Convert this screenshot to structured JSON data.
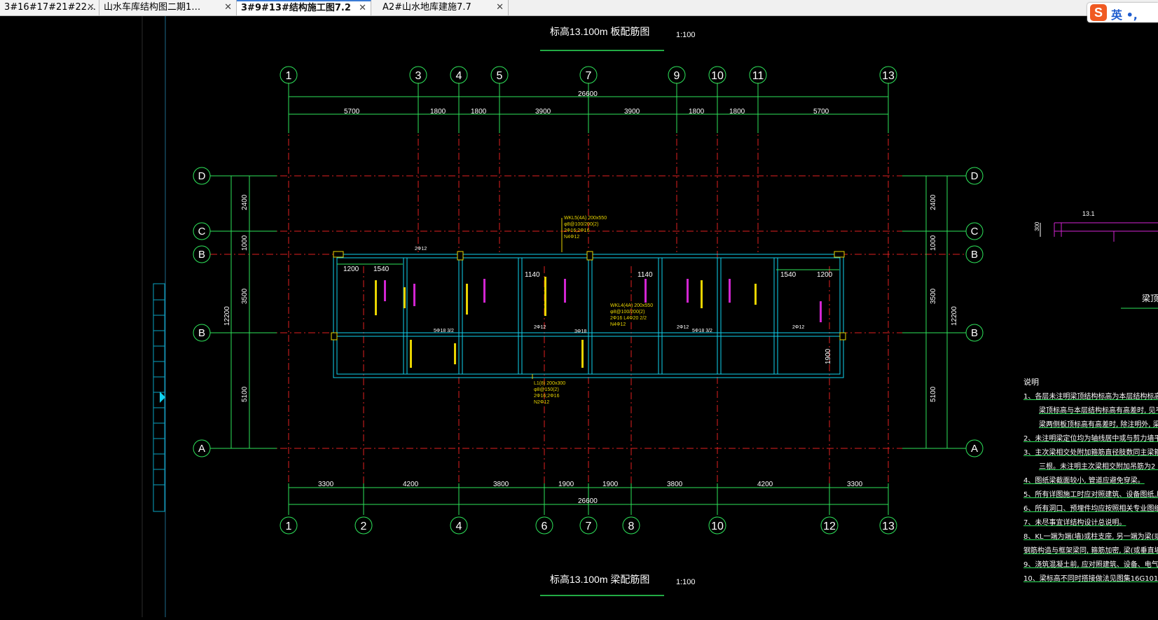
{
  "tabs": [
    {
      "label": "3#16#17#21#22…",
      "active": false
    },
    {
      "label": "山水车库结构图二期1…",
      "active": false
    },
    {
      "label": "3#9#13#结构施工图7.2",
      "active": true
    },
    {
      "label": "A2#山水地库建施7.7",
      "active": false
    }
  ],
  "tab_close_glyph": "✕",
  "ime": {
    "logo": "S",
    "text": "英 •,"
  },
  "drawing": {
    "top_title": "标高13.100m  板配筋图",
    "bottom_title": "标高13.100m  梁配筋图",
    "scale": "1:100",
    "top_axes": [
      "1",
      "3",
      "4",
      "5",
      "7",
      "9",
      "10",
      "11",
      "13"
    ],
    "bottom_axes": [
      "1",
      "2",
      "4",
      "6",
      "7",
      "8",
      "10",
      "12",
      "13"
    ],
    "left_axes": [
      "D",
      "C",
      "B",
      "B",
      "A"
    ],
    "right_axes": [
      "D",
      "C",
      "B",
      "B",
      "A"
    ],
    "top_total": "26600",
    "top_dims": [
      "5700",
      "1800",
      "1800",
      "3900",
      "3900",
      "1800",
      "1800",
      "5700"
    ],
    "bottom_total": "26600",
    "bottom_dims": [
      "3300",
      "4200",
      "3800",
      "1900",
      "1900",
      "3800",
      "4200",
      "3300"
    ],
    "left_dims": [
      "2400",
      "1000",
      "3500",
      "5100"
    ],
    "left_total": "12200",
    "right_dims": [
      "2400",
      "1000",
      "3500",
      "5100"
    ],
    "right_total": "12200",
    "plan_dims": [
      "1200",
      "1540",
      "1140",
      "1140",
      "1540",
      "1200",
      "1900"
    ],
    "beam_labels": [
      "WKL5(4A) 200x550",
      "φ8@100/200(2)",
      "2Φ16;2Φ16",
      "N4Φ12",
      "WKL4(4A) 200x550",
      "φ8@100/200(2)",
      "2Φ16 L4Φ20 2/2",
      "N4Φ12",
      "L1(8) 200x300",
      "φ8@150(2)",
      "2Φ16;2Φ16",
      "N2Φ12",
      "2Φ12",
      "3Φ18",
      "5Φ18 3/2",
      "2Φ12",
      "2Φ12",
      "5Φ18 3/2",
      "2Φ12"
    ],
    "right_section_label": "13.1",
    "right_section_dim": "300",
    "right_label": "梁顶"
  },
  "notes": {
    "title": "说明",
    "lines": [
      "1、各层未注明梁顶结构标高为本层结构标高, 当",
      "梁顶标高与本层结构标高有高差时, 见平面标",
      "梁两侧板顶标高有高差时, 除注明外, 梁顶标",
      "2、未注明梁定位均为轴线居中或与剪力墙平齐",
      "3、主次梁相交处附加箍筋直径肢数同主梁箍筋",
      "三根。未注明主次梁相交附加吊筋为2 Φ",
      "4、图纸梁截面较小, 管道应避免穿梁。",
      "5、所有详图施工时应对照建筑、设备图纸,尺寸",
      "6、所有洞口、预埋件均应按照相关专业图纸预留",
      "7、未尽事宜详结构设计总说明。",
      "8、KL一端为端(墙)或柱支座, 另一端为梁(或",
      "钢筋构造与框架梁同, 箍筋加密, 梁(或垂直墙)支座",
      "9、浇筑混凝土前, 应对照建筑、设备、电气图纸",
      "10、梁标高不同时搭接做法见图集16G101-1"
    ]
  }
}
